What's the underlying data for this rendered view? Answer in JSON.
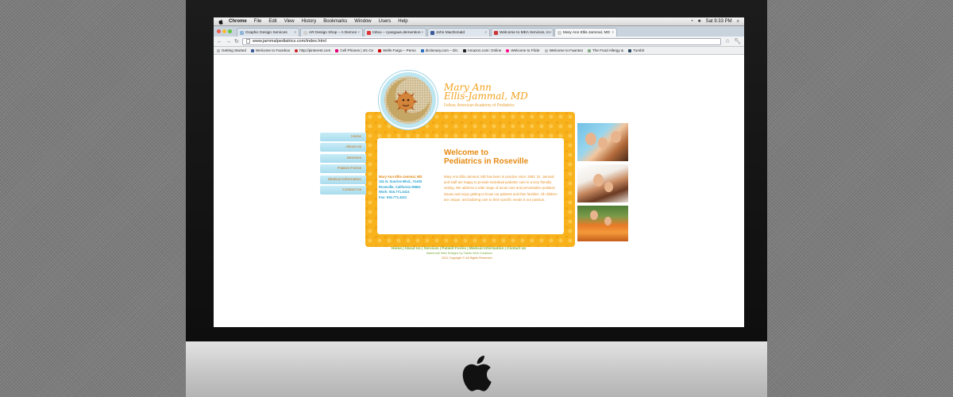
{
  "menubar": {
    "app": "Chrome",
    "items": [
      "File",
      "Edit",
      "View",
      "History",
      "Bookmarks",
      "Window",
      "Users",
      "Help"
    ],
    "clock": "Sat 9:33 PM"
  },
  "tabs": [
    {
      "label": "Graphic Design Services",
      "color": "#8fb6d8"
    },
    {
      "label": "AR Design Shop – A Demon",
      "color": "#d0d0d0"
    },
    {
      "label": "Inbox – ryangaus.demention",
      "color": "#d33"
    },
    {
      "label": "John MacDonald",
      "color": "#3b5998"
    },
    {
      "label": "Welcome to MEA Services, In",
      "color": "#c33"
    },
    {
      "label": "Mary Ann Ellis-Jammal, MD",
      "color": "#d0d0d0"
    }
  ],
  "omnibox": {
    "url": "www.jammalpediatrics.com/index.html"
  },
  "bookmarks": [
    {
      "label": "Getting Started",
      "color": "#bbb"
    },
    {
      "label": "Welcome to Faceboo",
      "color": "#3b5998"
    },
    {
      "label": "http://pinterest.com",
      "color": "#c8232c"
    },
    {
      "label": "Cell Phones | 4G Ce",
      "color": "#e20074"
    },
    {
      "label": "Wells Fargo – Perso",
      "color": "#c00"
    },
    {
      "label": "dictionary.com – Dic",
      "color": "#2a6fbe"
    },
    {
      "label": "Amazon.com: Online",
      "color": "#222"
    },
    {
      "label": "Welcome to Flickr",
      "color": "#ff0084"
    },
    {
      "label": "Welcome to Faantoo",
      "color": "#bbb"
    },
    {
      "label": "The Food Allergy &",
      "color": "#8a8"
    },
    {
      "label": "Tumblr",
      "color": "#2c4762"
    }
  ],
  "site": {
    "title_line1": "Mary Ann",
    "title_line2": "Ellis-Jammal, MD",
    "subtitle": "Fellow, American Academy of Pediatrics",
    "nav": [
      "Home",
      "About Us",
      "Services",
      "Patient Forms",
      "Medical Information",
      "Contact Us"
    ],
    "address": {
      "name": "Mary Ann Ellis-Jammal, MD",
      "street": "151 N. Sunrise Blvd., #1403",
      "city": "Roseville, California  95661",
      "work": "Work: 916.771.4414",
      "fax": "Fax: 916.771.4411"
    },
    "welcome_line1": "Welcome to",
    "welcome_line2": "Pediatrics in Roseville",
    "body": "Mary Ann Ellis-Jammal, MD has been in practice since 1993. Dr. Jammal and staff are happy to provide individual pediatric care in a very friendly setting. We address a wide range of acute care and preventative pediatric issues and enjoy getting to know our patients and their families. All children are unique, and tailoring care to their specific needs is our passion.",
    "footer_links": "Home | About Us | Services | Patient Forms | Medical Information | Contact Us",
    "footer_credit": "Mammoth Web Designs by Twists Web Creations",
    "footer_copy": "2011 Copyright © All Rights Reserved"
  },
  "colors": {
    "accent_orange": "#f8b21b",
    "nav_blue": "#a9dcee",
    "footer_green": "#7aaa3a"
  }
}
